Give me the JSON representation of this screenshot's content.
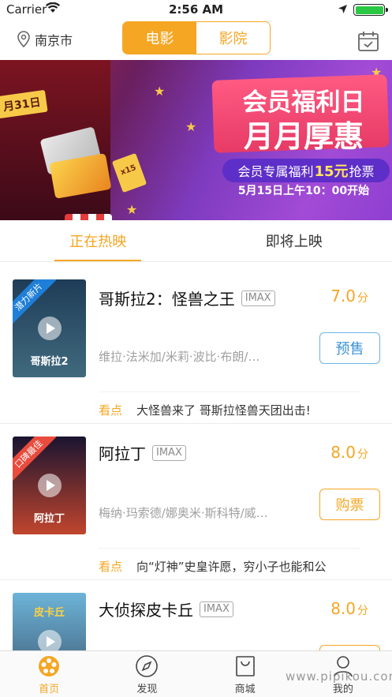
{
  "status_bar": {
    "carrier": "Carrier",
    "time": "2:56 AM",
    "battery_level": 1.0
  },
  "nav": {
    "city": "南京市",
    "segments": [
      {
        "label": "电影",
        "selected": true
      },
      {
        "label": "影院",
        "selected": false
      }
    ]
  },
  "banner": {
    "date_tag": "月31日",
    "ticket_label": "x15",
    "title_line1": "会员福利日",
    "title_line2": "月月厚惠",
    "ribbon_prefix": "会员专属福利",
    "ribbon_highlight": "15元",
    "ribbon_suffix": "抢票",
    "schedule": "5月15日上午10：00开始",
    "page_count": 4,
    "active_page": 1
  },
  "tabs": [
    {
      "label": "正在热映",
      "selected": true
    },
    {
      "label": "即将上映",
      "selected": false
    }
  ],
  "movies": [
    {
      "title": "哥斯拉2：怪兽之王",
      "format": "IMAX",
      "score": "7.0",
      "score_unit": "分",
      "cast": "维拉·法米加/米莉·波比·布朗/…",
      "button": "预售",
      "button_style": "presale",
      "highlight_label": "看点",
      "highlight": "大怪兽来了 哥斯拉怪兽天团出击!",
      "poster_tag": "潜力新片",
      "poster_title": "哥斯拉2",
      "poster_colors": [
        "#1f3c57",
        "#406a7e"
      ]
    },
    {
      "title": "阿拉丁",
      "format": "IMAX",
      "score": "8.0",
      "score_unit": "分",
      "cast": "梅纳·玛索德/娜奥米·斯科特/威…",
      "button": "购票",
      "button_style": "buy",
      "highlight_label": "看点",
      "highlight": "向“灯神”史皇许愿，穷小子也能和公",
      "poster_tag": "口碑最佳",
      "poster_title": "阿拉丁",
      "poster_colors": [
        "#1a1430",
        "#c1452d"
      ]
    },
    {
      "title": "大侦探皮卡丘",
      "format": "IMAX",
      "score": "8.0",
      "score_unit": "分",
      "poster_title": "皮卡丘",
      "poster_colors": [
        "#6db4d8",
        "#3d5670"
      ]
    }
  ],
  "tabbar": [
    {
      "label": "首页",
      "icon": "film-reel-icon",
      "selected": true
    },
    {
      "label": "发现",
      "icon": "compass-icon",
      "selected": false
    },
    {
      "label": "商城",
      "icon": "shopping-bag-icon",
      "selected": false
    },
    {
      "label": "我的",
      "icon": "user-icon",
      "selected": false
    }
  ],
  "watermark": "www.pipikou.com",
  "colors": {
    "accent": "#f5a623",
    "presale": "#3d94d6",
    "text_secondary": "#a0a0a0"
  }
}
